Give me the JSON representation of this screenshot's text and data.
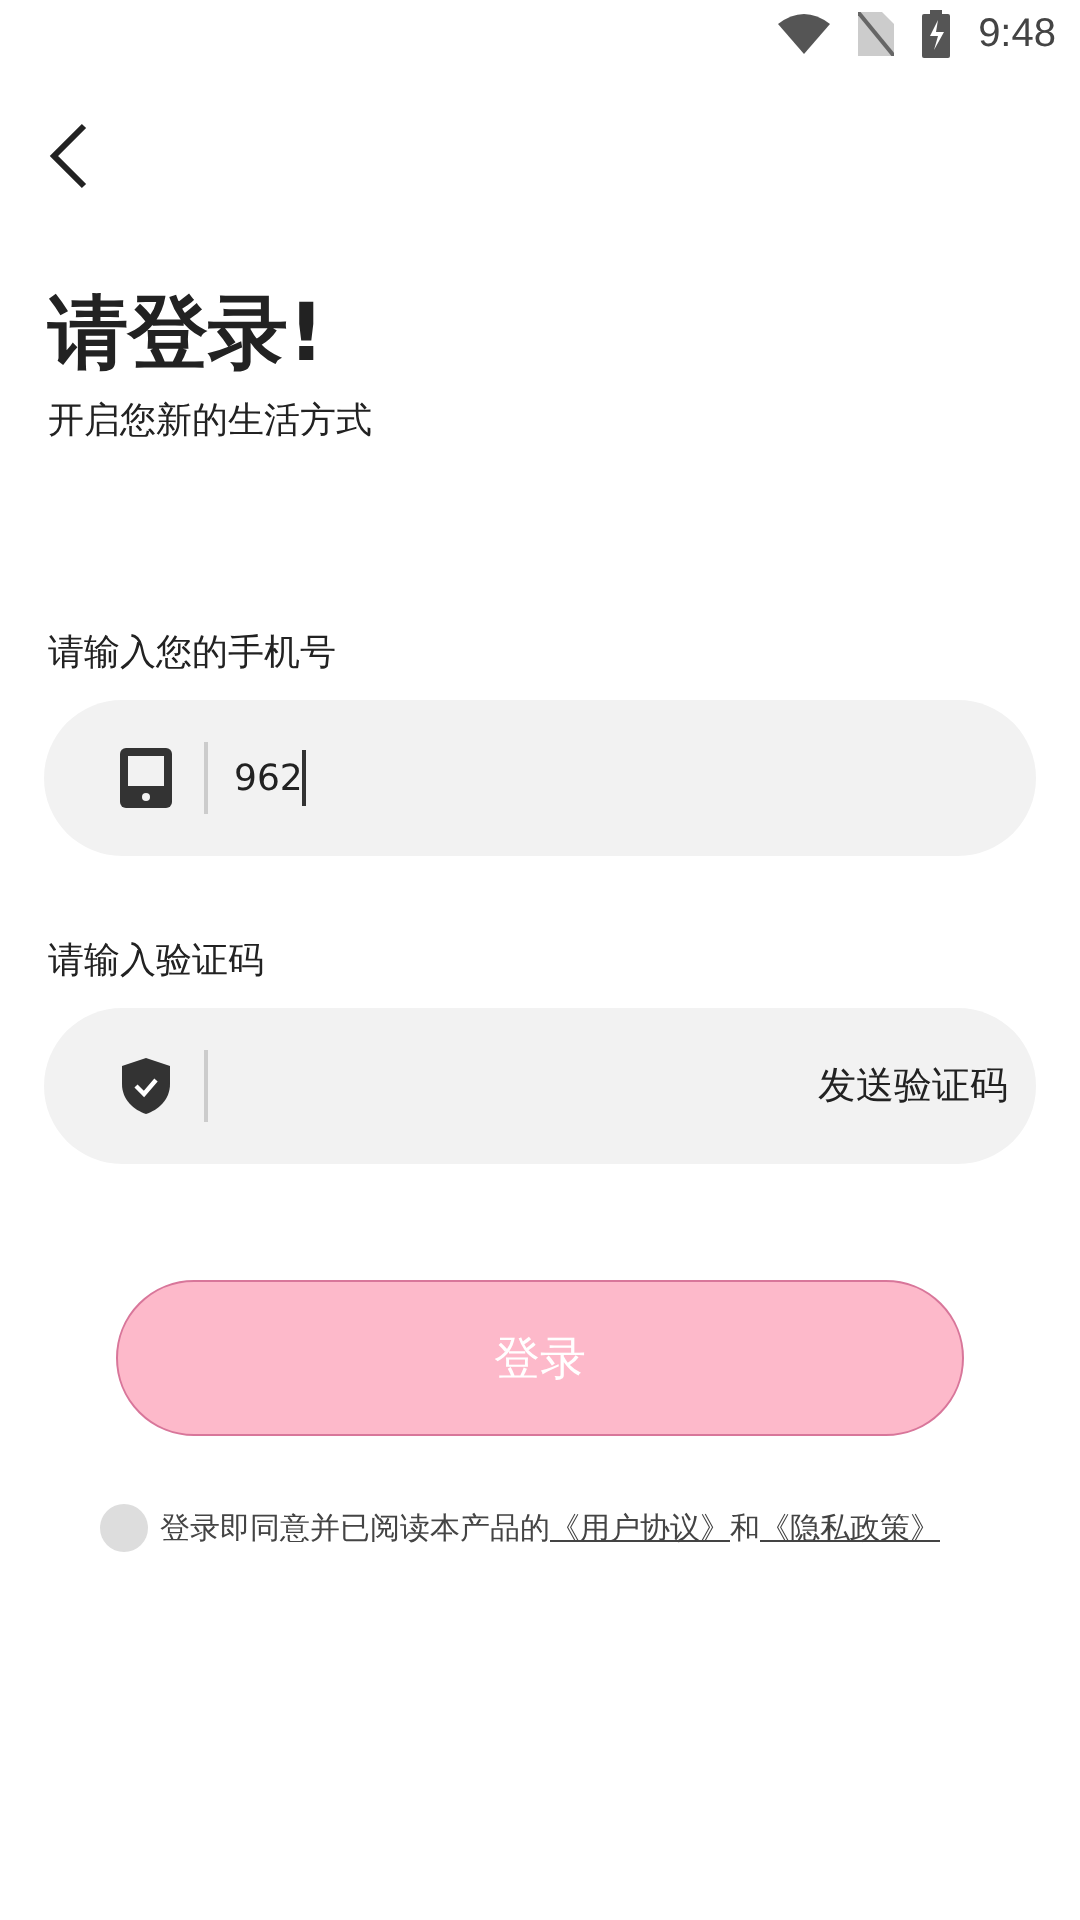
{
  "status_bar": {
    "time": "9:48"
  },
  "header": {
    "title": "请登录!",
    "subtitle": "开启您新的生活方式"
  },
  "fields": [
    {
      "kind": "phone",
      "label": "请输入您的手机号",
      "value": "962",
      "focused": true
    },
    {
      "kind": "code",
      "label": "请输入验证码",
      "focused": false,
      "action": "发送验证码"
    }
  ],
  "login_button": {
    "label": "登录",
    "disabled": true
  },
  "agreement": {
    "checked": false,
    "text": "登录即同意并已阅读本产品的",
    "links": [
      "《用户协议》",
      "《隐私政策》"
    ],
    "joiner": "和"
  }
}
